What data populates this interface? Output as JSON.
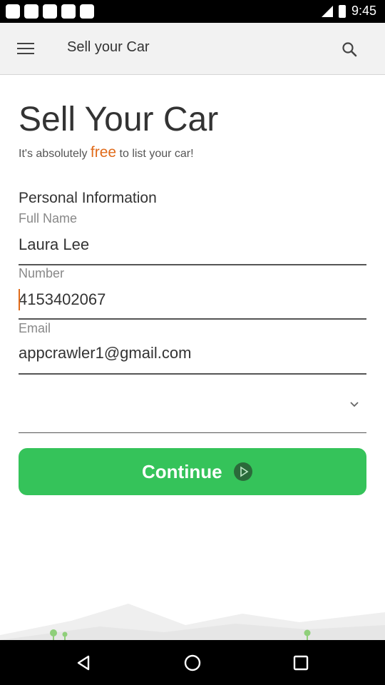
{
  "status_bar": {
    "time": "9:45"
  },
  "app_bar": {
    "title": "Sell your Car"
  },
  "hero": {
    "title": "Sell Your Car",
    "subtitle_pre": "It's absolutely",
    "subtitle_free": "free",
    "subtitle_post": "to list your car!"
  },
  "form": {
    "section_title": "Personal Information",
    "full_name": {
      "label": "Full Name",
      "value": "Laura Lee"
    },
    "number": {
      "label": "Number",
      "value": "4153402067"
    },
    "email": {
      "label": "Email",
      "value": "appcrawler1@gmail.com"
    },
    "dropdown": {
      "value": ""
    },
    "continue_label": "Continue"
  },
  "colors": {
    "accent_orange": "#e06b1a",
    "continue_green": "#35c35a"
  }
}
